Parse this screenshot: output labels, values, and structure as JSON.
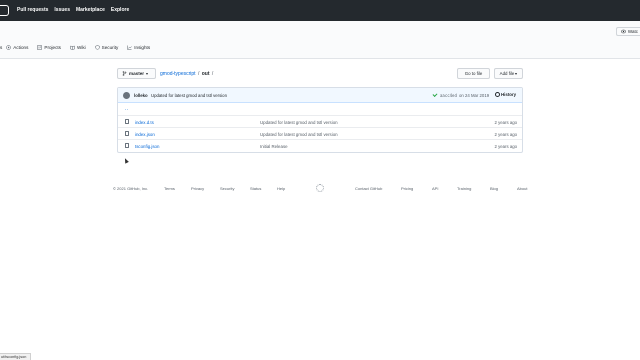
{
  "topnav": {
    "items": [
      {
        "label": "Pull requests"
      },
      {
        "label": "Issues"
      },
      {
        "label": "Marketplace"
      },
      {
        "label": "Explore"
      }
    ]
  },
  "repo_header": {
    "watch_label": "Watc",
    "tabs": [
      {
        "label": "s",
        "icon": "fragment-icon"
      },
      {
        "label": "Actions",
        "icon": "play-icon"
      },
      {
        "label": "Projects",
        "icon": "project-icon"
      },
      {
        "label": "Wiki",
        "icon": "book-icon"
      },
      {
        "label": "Security",
        "icon": "shield-icon"
      },
      {
        "label": "Insights",
        "icon": "graph-icon"
      }
    ]
  },
  "file_nav": {
    "branch": "master",
    "repo": "gmod-typescript",
    "separator": "/",
    "current_dir": "out",
    "trailing_sep": "/",
    "goto_label": "Go to file",
    "add_file_label": "Add file"
  },
  "commit": {
    "author": "lolleko",
    "message": "Updated for latest gmod and tstl version",
    "sha": "aacc4ed",
    "date": "on 24 Mar 2019",
    "history_label": "History"
  },
  "files": {
    "parent": "..",
    "rows": [
      {
        "name": "index.d.ts",
        "message": "Updated for latest gmod and tstl version",
        "age": "2 years ago"
      },
      {
        "name": "index.json",
        "message": "Updated for latest gmod and tstl version",
        "age": "2 years ago"
      },
      {
        "name": "tsconfig.json",
        "message": "Initial Release",
        "age": "2 years ago"
      }
    ]
  },
  "footer": {
    "copyright": "© 2021 GitHub, Inc.",
    "links": [
      "Terms",
      "Privacy",
      "Security",
      "Status",
      "Help",
      "Contact GitHub",
      "Pricing",
      "API",
      "Training",
      "Blog",
      "About"
    ]
  },
  "status_url": "ut/tsconfig.json",
  "colors": {
    "topbar": "#24292e",
    "link": "#0366d6",
    "commit_bar": "#f1f8ff",
    "check": "#28a745"
  }
}
